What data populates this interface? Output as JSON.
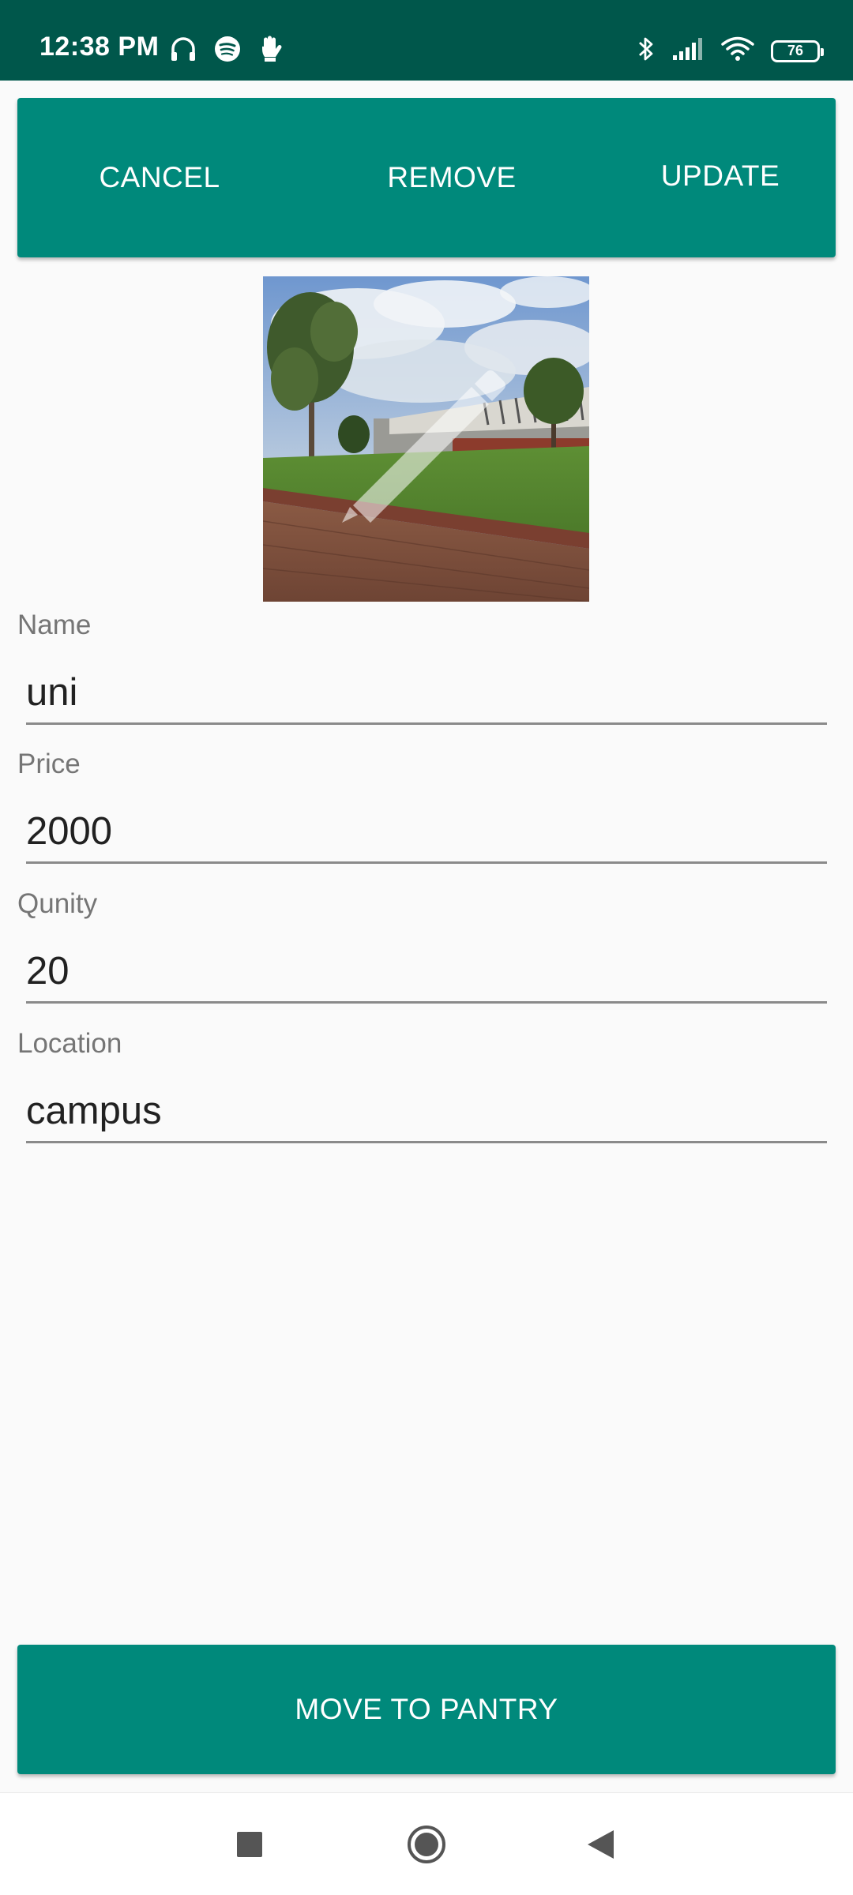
{
  "status_bar": {
    "time": "12:38 PM",
    "battery_level": "76",
    "left_icons": [
      "headphones-icon",
      "spotify-icon",
      "hand-icon"
    ],
    "right_icons": [
      "bluetooth-icon",
      "cellular-signal-icon",
      "wifi-icon",
      "battery-icon"
    ]
  },
  "action_bar": {
    "cancel_label": "CANCEL",
    "remove_label": "REMOVE",
    "update_label": "UPDATE",
    "color": "#00897b"
  },
  "item_image": {
    "overlay_icon": "edit-pencil-icon"
  },
  "form": {
    "name": {
      "label": "Name",
      "value": "uni"
    },
    "price": {
      "label": "Price",
      "value": "2000"
    },
    "quantity": {
      "label": "Qunity",
      "value": "20"
    },
    "location": {
      "label": "Location",
      "value": "campus"
    }
  },
  "bottom_button": {
    "label": "MOVE TO PANTRY"
  },
  "nav_bar": {
    "recents_icon": "recents-square-icon",
    "home_icon": "home-circle-icon",
    "back_icon": "back-triangle-icon"
  },
  "colors": {
    "status_bar": "#00574b",
    "primary": "#00897b",
    "background": "#fafafa"
  }
}
